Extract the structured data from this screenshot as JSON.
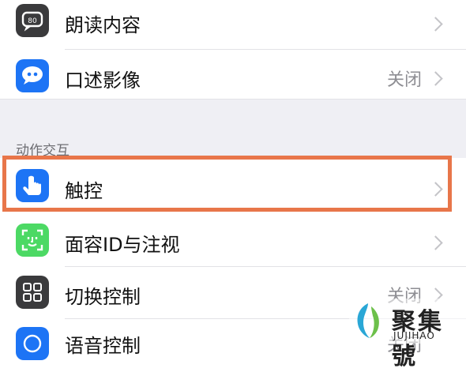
{
  "rows": [
    {
      "label": "朗读内容",
      "value": ""
    },
    {
      "label": "口述影像",
      "value": "关闭"
    },
    {
      "label": "触控",
      "value": ""
    },
    {
      "label": "面容ID与注视",
      "value": ""
    },
    {
      "label": "切换控制",
      "value": "关闭"
    },
    {
      "label": "语音控制",
      "value": "关闭"
    }
  ],
  "section_header": "动作交互",
  "icons": [
    "speech-bubble-icon",
    "quote-bubble-icon",
    "hand-pointer-icon",
    "face-id-icon",
    "grid-icon",
    "voice-control-icon"
  ],
  "colors": {
    "highlight": "#e8764a",
    "icon_dark": "#3a3a3c",
    "icon_blue": "#1d74f5",
    "icon_green": "#4cd964"
  },
  "watermark": {
    "title": "聚集號",
    "subtitle": "JUJIHAO"
  }
}
